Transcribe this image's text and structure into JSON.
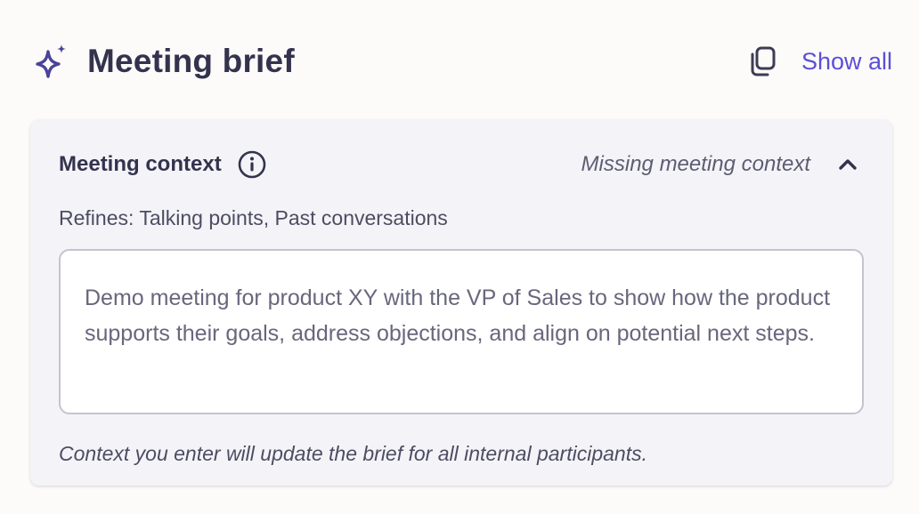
{
  "header": {
    "title": "Meeting brief",
    "title_icon": "sparkle-icon",
    "copy_icon": "copy-icon",
    "show_all_label": "Show all"
  },
  "card": {
    "title": "Meeting context",
    "info_icon": "info-icon",
    "status": "Missing meeting context",
    "collapse_icon": "chevron-up-icon",
    "refines": "Refines: Talking points, Past conversations",
    "input_value": "Demo meeting for product XY with the VP of Sales to show how the product supports their goals, address objections, and align on potential next steps.",
    "footnote": "Context you enter will update the brief for all internal participants."
  },
  "colors": {
    "accent": "#5a4fd8",
    "sparkle": "#4a4399",
    "text_dark": "#34334e",
    "card_bg": "#f4f4f8",
    "page_bg": "#fcfbf9"
  }
}
